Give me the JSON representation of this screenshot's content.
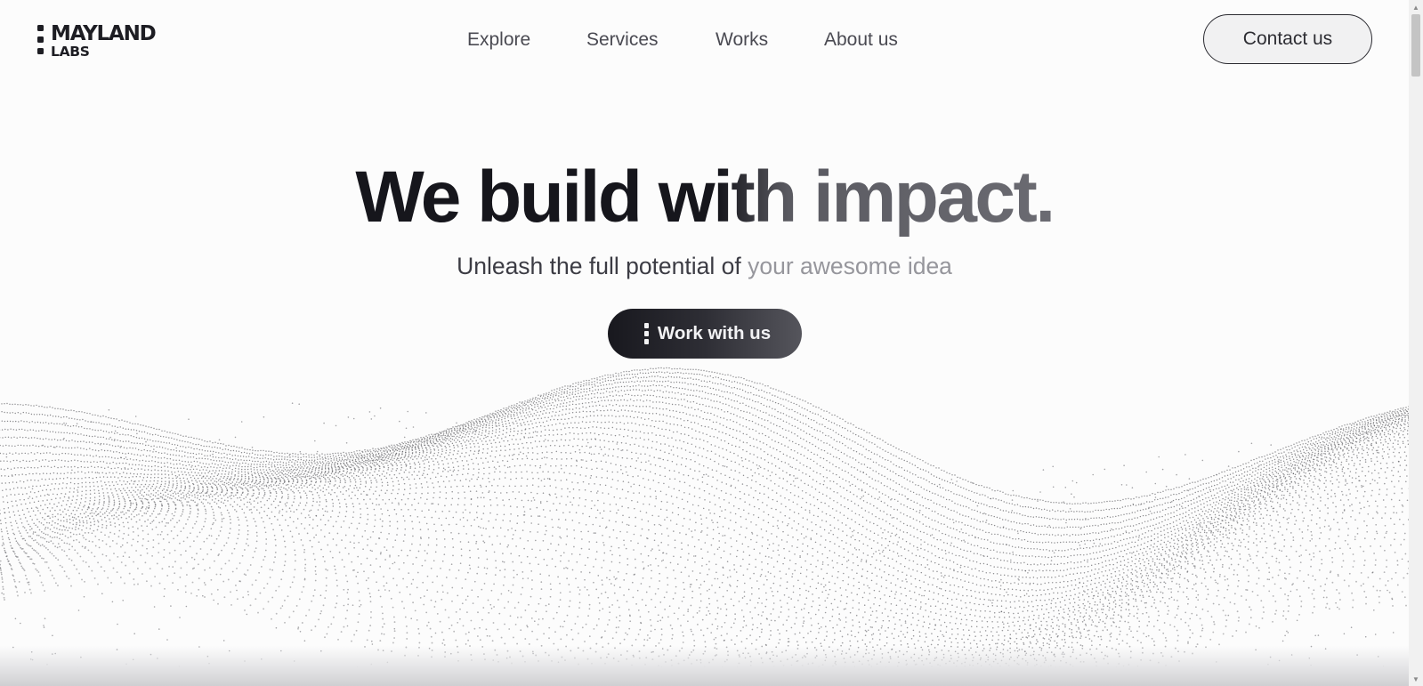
{
  "brand": {
    "line1": "MAYLAND",
    "line2": "LABS"
  },
  "nav": [
    {
      "label": "Explore"
    },
    {
      "label": "Services"
    },
    {
      "label": "Works"
    },
    {
      "label": "About us"
    }
  ],
  "header": {
    "contact_label": "Contact us"
  },
  "hero": {
    "headline": "We build with impact.",
    "subtitle_dark": "Unleash the full potential of",
    "subtitle_light": "your awesome idea",
    "cta_label": "Work with us"
  },
  "colors": {
    "ink": "#1d1d23",
    "muted": "#96969c",
    "background": "#fcfcfc"
  },
  "icons": {
    "scroll_up": "triangle-up-icon",
    "scroll_down": "triangle-down-icon"
  }
}
